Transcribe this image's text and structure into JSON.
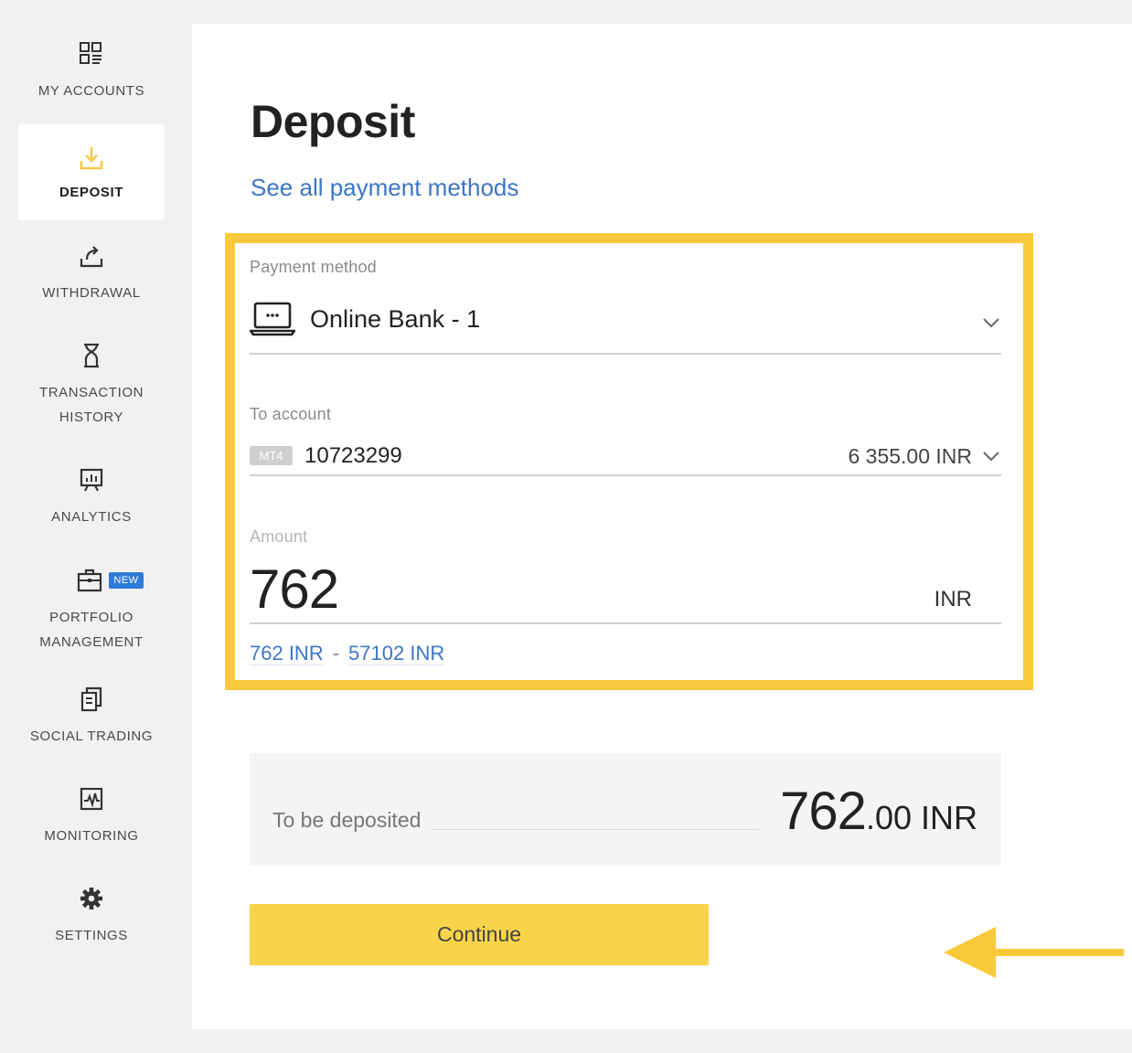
{
  "sidebar": {
    "items": [
      {
        "label": "MY ACCOUNTS",
        "icon": "accounts-grid-icon"
      },
      {
        "label": "DEPOSIT",
        "icon": "download-icon"
      },
      {
        "label": "WITHDRAWAL",
        "icon": "upload-arrow-icon"
      },
      {
        "label": "TRANSACTION HISTORY",
        "icon": "hourglass-icon"
      },
      {
        "label": "ANALYTICS",
        "icon": "analytics-board-icon"
      },
      {
        "label": "PORTFOLIO MANAGEMENT",
        "icon": "briefcase-icon",
        "badge": "NEW"
      },
      {
        "label": "SOCIAL TRADING",
        "icon": "copy-documents-icon"
      },
      {
        "label": "MONITORING",
        "icon": "monitoring-chart-icon"
      },
      {
        "label": "SETTINGS",
        "icon": "gear-icon"
      }
    ],
    "active_color": "#f8c94a",
    "badge_color": "#2f7ad6"
  },
  "main": {
    "title": "Deposit",
    "see_all_link": "See all payment methods",
    "payment_method": {
      "label": "Payment method",
      "value": "Online Bank - 1",
      "icon": "laptop-icon"
    },
    "to_account": {
      "label": "To account",
      "platform": "MT4",
      "number": "10723299",
      "balance": "6 355.00 INR"
    },
    "amount": {
      "label": "Amount",
      "value": "762",
      "currency": "INR",
      "min": "762 INR",
      "separator": "-",
      "max": "57102 INR"
    },
    "summary": {
      "label": "To be deposited",
      "value_integer": "762",
      "value_decimal": ".00 INR"
    },
    "continue_label": "Continue"
  },
  "colors": {
    "highlight": "#fac93b",
    "link": "#3d76c7",
    "button": "#f8d44b"
  }
}
